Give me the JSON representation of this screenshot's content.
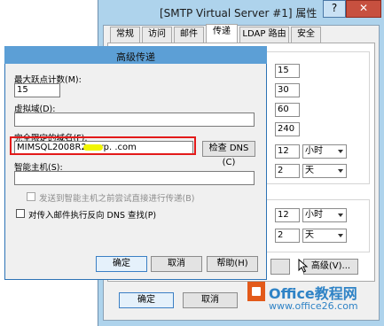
{
  "properties_window": {
    "title": "[SMTP Virtual Server #1] 属性",
    "help_glyph": "?",
    "close_glyph": "✕",
    "tabs": [
      {
        "label": "常规"
      },
      {
        "label": "访问"
      },
      {
        "label": "邮件"
      },
      {
        "label": "传递",
        "active": true
      },
      {
        "label": "LDAP 路由"
      },
      {
        "label": "安全"
      }
    ],
    "outbound_values": [
      "15",
      "30",
      "60",
      "240"
    ],
    "delay_notification": {
      "value": "12",
      "unit": "小时"
    },
    "expiration_timeout": {
      "value": "2",
      "unit": "天"
    },
    "local_delay_notification": {
      "value": "12",
      "unit": "小时"
    },
    "local_expiration_timeout": {
      "value": "2",
      "unit": "天"
    },
    "advanced_button": "高级(V)...",
    "ok_button": "确定",
    "cancel_button": "取消"
  },
  "advanced_dialog": {
    "title": "高级传递",
    "max_hop_count": {
      "label": "最大跃点计数(M):",
      "value": "15"
    },
    "masquerade_domain": {
      "label": "虚拟域(D):",
      "value": ""
    },
    "fqdn": {
      "label": "完全限定的域名(F):",
      "value": "MIMSQL2008R2.corp.       .com"
    },
    "check_dns_button": "检查 DNS (C)",
    "smart_host": {
      "label": "智能主机(S):",
      "value": ""
    },
    "try_direct": {
      "label": "发送到智能主机之前尝试直接进行传递(B)",
      "checked": false,
      "disabled": true
    },
    "reverse_dns": {
      "label": "对传入邮件执行反向 DNS 查找(P)",
      "checked": false
    },
    "ok_button": "确定",
    "cancel_button": "取消",
    "help_button": "帮助(H)"
  },
  "watermark": {
    "brand": "Office教程网",
    "url": "www.office26.com",
    "icon": "office-logo-icon"
  },
  "colors": {
    "highlight_border": "#e31a1a",
    "window_frame": "#aed3ec",
    "dialog_title": "#5c9fd6",
    "watermark_blue": "#2f83c6",
    "watermark_orange": "#e35a1a"
  }
}
